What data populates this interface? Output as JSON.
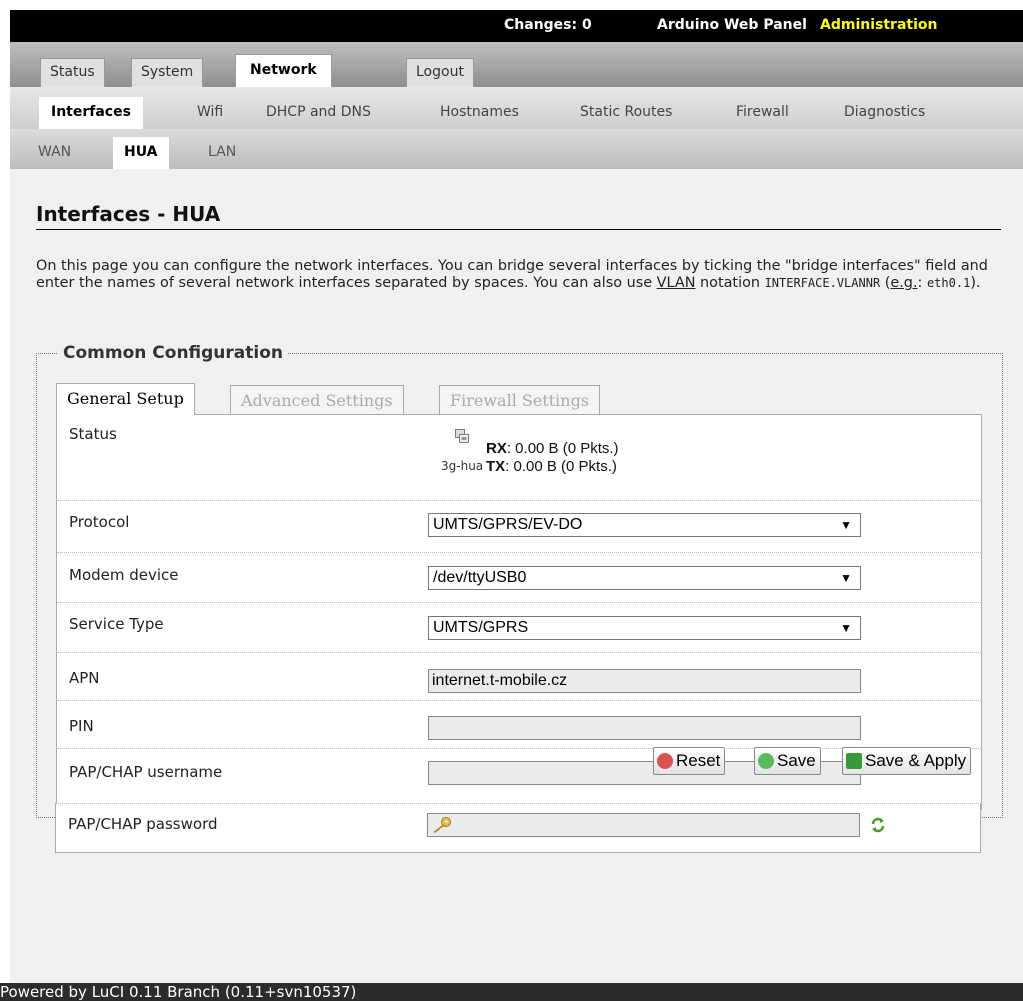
{
  "header": {
    "changes": "Changes: 0",
    "panel_title": "Arduino Web Panel",
    "admin": "Administration"
  },
  "main_tabs": {
    "status": "Status",
    "system": "System",
    "network": "Network",
    "logout": "Logout"
  },
  "sub_tabs": {
    "interfaces": "Interfaces",
    "wifi": "Wifi",
    "dhcp_dns": "DHCP and DNS",
    "hostnames": "Hostnames",
    "static_routes": "Static Routes",
    "firewall": "Firewall",
    "diagnostics": "Diagnostics"
  },
  "iface_tabs": {
    "wan": "WAN",
    "hua": "HUA",
    "lan": "LAN"
  },
  "page": {
    "title": "Interfaces - HUA",
    "desc_1": "On this page you can configure the network interfaces. You can bridge several interfaces by ticking the \"bridge interfaces\" field and enter the names of several network interfaces separated by spaces. You can also use ",
    "desc_vlan": "VLAN",
    "desc_2": " notation ",
    "desc_mono1": "INTERFACE.VLANNR",
    "desc_3": " (",
    "desc_eg": "e.g.",
    "desc_4": ": ",
    "desc_mono2": "eth0.1",
    "desc_5": ")."
  },
  "config": {
    "legend": "Common Configuration",
    "tabs": {
      "general": "General Setup",
      "advanced": "Advanced Settings",
      "firewall": "Firewall Settings"
    },
    "status": {
      "label": "Status",
      "ifname": "3g-hua",
      "rx_label": "RX",
      "rx_value": ": 0.00 B (0 Pkts.)",
      "tx_label": "TX",
      "tx_value": ": 0.00 B (0 Pkts.)"
    },
    "protocol": {
      "label": "Protocol",
      "value": "UMTS/GPRS/EV-DO"
    },
    "modem": {
      "label": "Modem device",
      "value": "/dev/ttyUSB0"
    },
    "service": {
      "label": "Service Type",
      "value": "UMTS/GPRS"
    },
    "apn": {
      "label": "APN",
      "value": "internet.t-mobile.cz"
    },
    "pin": {
      "label": "PIN",
      "value": ""
    },
    "username": {
      "label": "PAP/CHAP username",
      "value": ""
    },
    "password": {
      "label": "PAP/CHAP password",
      "value": ""
    }
  },
  "buttons": {
    "reset": "Reset",
    "save": "Save",
    "save_apply": "Save & Apply"
  },
  "footer": {
    "text": "Powered by LuCI 0.11 Branch (0.11+svn10537)"
  }
}
